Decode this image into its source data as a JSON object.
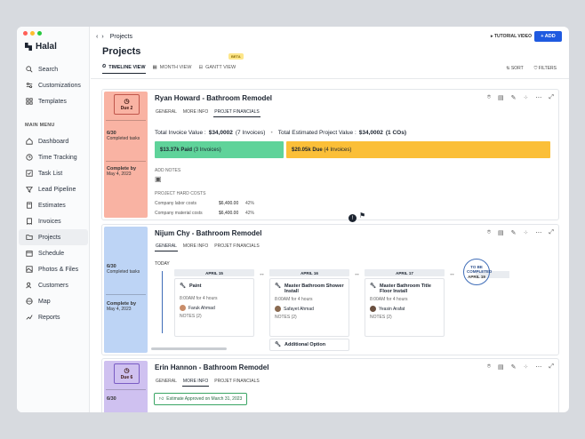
{
  "app": {
    "name": "Halal",
    "breadcrumb": "Projects",
    "add_label": "+ ADD",
    "tutorial_label": "▸ TUTORIAL VIDEO",
    "page_title": "Projects",
    "beta": "BETA"
  },
  "sidebar": {
    "top_items": [
      {
        "label": "Search",
        "icon": "search-icon"
      },
      {
        "label": "Customizations",
        "icon": "sliders-icon"
      },
      {
        "label": "Templates",
        "icon": "grid-icon"
      }
    ],
    "menu_heading": "MAIN MENU",
    "items": [
      {
        "label": "Dashboard",
        "icon": "dashboard-icon"
      },
      {
        "label": "Time Tracking",
        "icon": "clock-icon"
      },
      {
        "label": "Task List",
        "icon": "checklist-icon"
      },
      {
        "label": "Lead Pipeline",
        "icon": "pipeline-icon"
      },
      {
        "label": "Estimates",
        "icon": "calculator-icon"
      },
      {
        "label": "Invoices",
        "icon": "invoice-icon"
      },
      {
        "label": "Projects",
        "icon": "folder-icon",
        "active": true
      },
      {
        "label": "Schedule",
        "icon": "calendar-icon"
      },
      {
        "label": "Photos & Files",
        "icon": "image-icon"
      },
      {
        "label": "Customers",
        "icon": "users-icon"
      },
      {
        "label": "Map",
        "icon": "map-icon"
      },
      {
        "label": "Reports",
        "icon": "chart-icon"
      }
    ]
  },
  "views": [
    {
      "label": "TIMELINE VIEW",
      "active": true
    },
    {
      "label": "MONTH VIEW"
    },
    {
      "label": "GANTT VIEW"
    }
  ],
  "tools": {
    "sort": "SORT",
    "filters": "FILTERS"
  },
  "cards": [
    {
      "name": "Ryan Howard - Bathroom Remodel",
      "color": "#f9b3a3",
      "due": "Due 2",
      "completed": "6/30",
      "completed_label": "Completed tasks",
      "complete_by_label": "Complete by",
      "complete_by": "May 4, 2023",
      "tabs": [
        "GENERAL",
        "MORE INFO",
        "PROJET FINANCIALS"
      ],
      "active_tab": 2,
      "invoice_label": "Total Invoice Value :",
      "invoice_value": "$34,0002",
      "invoice_count": "(7 Invoices)",
      "estimate_label": "Total Estimated Project Value :",
      "estimate_value": "$34,0002",
      "estimate_cos": "(1 COs)",
      "paid_amount": "$13.37k Paid",
      "paid_count": "(3 Invoices)",
      "due_amount": "$20.05k Due",
      "due_count": "(4 Invoices)",
      "paid_fraction": 0.333,
      "add_notes": "ADD NOTES",
      "hard_costs": "PROJECT HARD COSTS",
      "costs": [
        {
          "label": "Company labor costs",
          "value": "$6,400.00",
          "pct": "42%"
        },
        {
          "label": "Company material costs",
          "value": "$6,400.00",
          "pct": "42%"
        }
      ]
    },
    {
      "name": "Nijum Chy - Bathroom Remodel",
      "color": "#bdd4f5",
      "completed": "6/30",
      "completed_label": "Completed tasks",
      "complete_by_label": "Complete by",
      "complete_by": "May 4, 2023",
      "tabs": [
        "GENERAL",
        "MORE INFO",
        "PROJET FINANCIALS"
      ],
      "active_tab": 0,
      "today": "TODAY",
      "columns": [
        {
          "date": "APRIL 15",
          "task": "Paint",
          "time": "8:00AM for 4 hours",
          "person": "Faruk Ahmad",
          "notes": "NOTES (2)"
        },
        {
          "date": "APRIL 16",
          "task": "Master Bathroom Shower Install",
          "time": "8:00AM for 4 hours",
          "person": "Safayet Ahmad",
          "notes": "NOTES (2)",
          "extra": "Additional Option"
        },
        {
          "date": "APRIL 17",
          "task": "Master Bathroom Title Floor Install",
          "time": "8:00AM for 4 hours",
          "person": "Yeasin Arafat",
          "notes": "NOTES (2)"
        }
      ],
      "tbc": "TO BE COMPLETED",
      "tbc_date": "APRIL 19"
    },
    {
      "name": "Erin Hannon - Bathroom Remodel",
      "color": "#cfc1f0",
      "due": "Due 6",
      "completed": "6/30",
      "tabs": [
        "GENERAL",
        "MORE INFO",
        "PROJET FINANCIALS"
      ],
      "active_tab": 1,
      "approved": "Estimate Approved on March 31, 2023"
    }
  ]
}
